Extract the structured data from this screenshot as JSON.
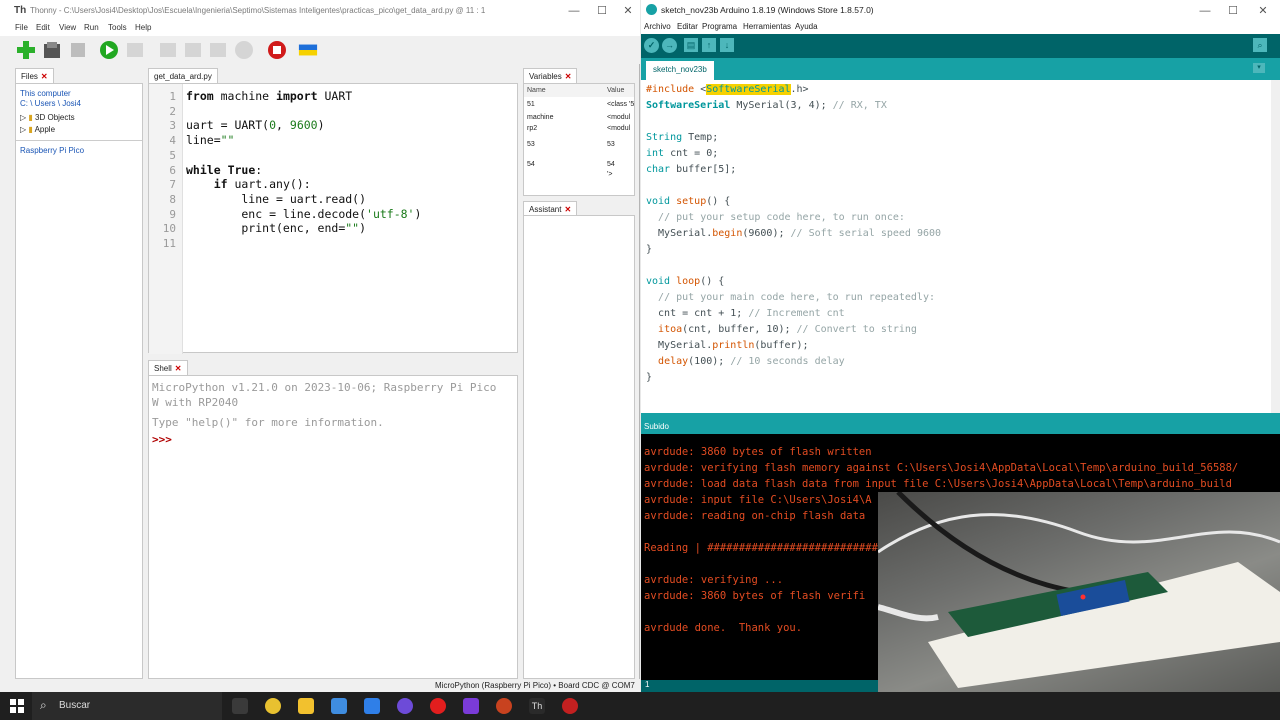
{
  "thonny": {
    "title": "Thonny  -  C:\\Users\\Josi4\\Desktop\\Jos\\Escuela\\Ingenieria\\Septimo\\Sistemas Inteligentes\\practicas_pico\\get_data_ard.py  @  11 : 1",
    "menu": [
      "File",
      "Edit",
      "View",
      "Run",
      "Tools",
      "Help"
    ],
    "files_tab": "Files",
    "this_computer": "This computer",
    "path": "C: \\ Users \\ Josi4",
    "tree": [
      "3D Objects",
      "Apple"
    ],
    "device": "Raspberry Pi Pico",
    "editor_tab": "get_data_ard.py",
    "line_numbers": [
      "1",
      "2",
      "3",
      "4",
      "5",
      "6",
      "7",
      "8",
      "9",
      "10",
      "11"
    ],
    "shell_tab": "Shell",
    "shell_line1": "MicroPython v1.21.0 on 2023-10-06; Raspberry Pi Pico",
    "shell_line2": "W with RP2040",
    "shell_line3": "Type \"help()\" for more information.",
    "shell_prompt": ">>>",
    "variables_tab": "Variables",
    "var_headers": [
      "Name",
      "Value"
    ],
    "variables": [
      {
        "name": "51",
        "value": "<class '5"
      },
      {
        "name": "machine",
        "value": "<modul"
      },
      {
        "name": "rp2",
        "value": "<modul"
      },
      {
        "name": "53",
        "value": "53"
      },
      {
        "name": "54",
        "value": "54"
      },
      {
        "name": "",
        "value": "'>"
      }
    ],
    "assistant_tab": "Assistant",
    "status": "MicroPython (Raspberry Pi Pico)  •  Board CDC @ COM7"
  },
  "arduino": {
    "title": "sketch_nov23b Arduino 1.8.19 (Windows Store 1.8.57.0)",
    "menu": [
      "Archivo",
      "Editar",
      "Programa",
      "Herramientas",
      "Ayuda"
    ],
    "tab": "sketch_nov23b",
    "status": "Subido",
    "console": [
      "avrdude: 3860 bytes of flash written",
      "avrdude: verifying flash memory against C:\\Users\\Josi4\\AppData\\Local\\Temp\\arduino_build_56588/",
      "avrdude: load data flash data from input file C:\\Users\\Josi4\\AppData\\Local\\Temp\\arduino_build",
      "avrdude: input file C:\\Users\\Josi4\\A",
      "avrdude: reading on-chip flash data",
      "",
      "Reading | ##############################",
      "",
      "avrdude: verifying ...",
      "avrdude: 3860 bytes of flash verifi",
      "",
      "avrdude done.  Thank you."
    ],
    "line_indicator": "1"
  },
  "taskbar": {
    "search": "Buscar"
  },
  "colors": {
    "arduino_teal": "#006468",
    "arduino_light": "#17a1a5",
    "console_orange": "#e34c22"
  }
}
